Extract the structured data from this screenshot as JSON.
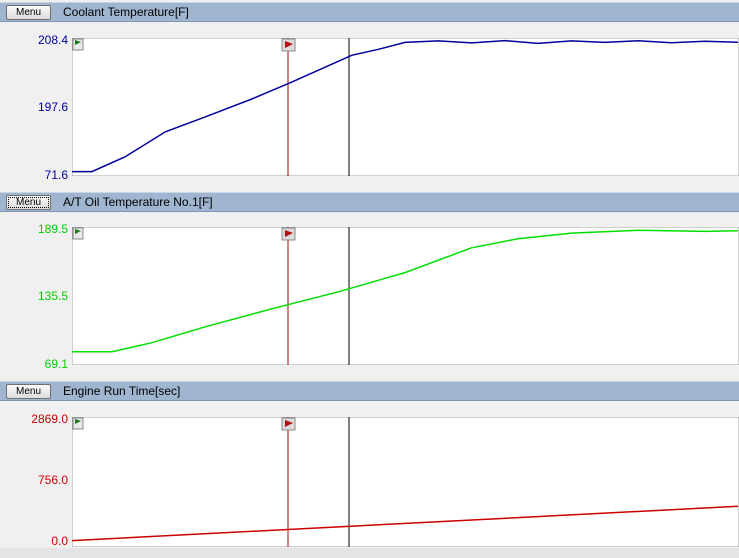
{
  "panels": [
    {
      "menu_label": "Menu",
      "title": "Coolant Temperature[F]",
      "color": "#00009c",
      "y_ticks": [
        "208.4",
        "197.6",
        "71.6"
      ]
    },
    {
      "menu_label": "Menu",
      "title": "A/T Oil Temperature No.1[F]",
      "color": "#00e000",
      "y_ticks": [
        "189.5",
        "135.5",
        "69.1"
      ]
    },
    {
      "menu_label": "Menu",
      "title": "Engine Run Time[sec]",
      "color": "#cc0000",
      "y_ticks": [
        "2869.0",
        "756.0",
        "0.0"
      ]
    }
  ],
  "cursor_colors": {
    "marker": "#b00000",
    "cursor": "#000000"
  },
  "chart_data": [
    {
      "type": "line",
      "title": "Coolant Temperature[F]",
      "ylim": [
        71.6,
        208.4
      ],
      "y_ticks": [
        71.6,
        197.6,
        208.4
      ],
      "grid": false,
      "x": [
        0,
        0.03,
        0.08,
        0.14,
        0.2,
        0.27,
        0.33,
        0.38,
        0.42,
        0.46,
        0.5,
        0.55,
        0.6,
        0.65,
        0.7,
        0.75,
        0.8,
        0.85,
        0.9,
        0.95,
        1.0
      ],
      "values": [
        75.0,
        75.0,
        90.0,
        115.0,
        130.0,
        148.0,
        165.0,
        180.0,
        192.0,
        198.0,
        205.0,
        206.5,
        204.5,
        206.8,
        204.0,
        206.5,
        205.0,
        206.6,
        204.6,
        206.2,
        205.2
      ]
    },
    {
      "type": "line",
      "title": "A/T Oil Temperature No.1[F]",
      "ylim": [
        69.1,
        189.5
      ],
      "y_ticks": [
        69.1,
        135.5,
        189.5
      ],
      "grid": false,
      "x": [
        0,
        0.06,
        0.12,
        0.2,
        0.3,
        0.4,
        0.5,
        0.6,
        0.67,
        0.75,
        0.85,
        0.95,
        1.0
      ],
      "values": [
        80.0,
        80.0,
        88.0,
        102.0,
        118.0,
        133.0,
        150.0,
        172.0,
        180.0,
        185.0,
        187.5,
        186.5,
        187.0
      ]
    },
    {
      "type": "line",
      "title": "Engine Run Time[sec]",
      "ylim": [
        0.0,
        2869.0
      ],
      "y_ticks": [
        0.0,
        756.0,
        2869.0
      ],
      "grid": false,
      "x": [
        0,
        1.0
      ],
      "values": [
        120.0,
        890.0
      ]
    }
  ]
}
